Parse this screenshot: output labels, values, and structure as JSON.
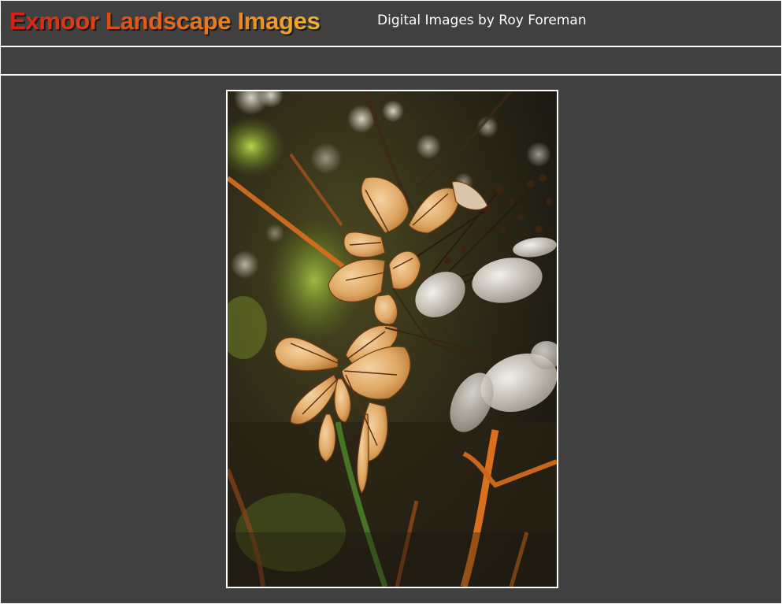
{
  "header": {
    "site_title": "Exmoor Landscape Images",
    "subtitle": "Digital Images by Roy Foreman"
  },
  "photo": {
    "subject": "backlit dried hydrangea flowers",
    "colors": {
      "petal": "#e2b27a",
      "vein": "#5a2e10",
      "stem": "#d9701e",
      "foliage": "#9bc23a",
      "shadow": "#1d1a12"
    }
  }
}
